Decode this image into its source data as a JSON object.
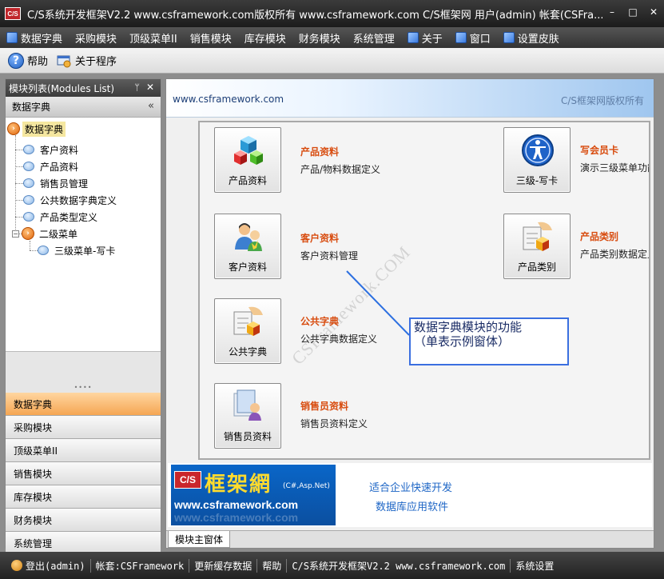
{
  "window": {
    "title": "C/S系统开发框架V2.2 www.csframework.com版权所有 www.csframework.com C/S框架网 用户(admin) 帐套(CSFra...",
    "logo_text": "C/S",
    "minimize": "–",
    "maximize": "□",
    "close": "✕"
  },
  "menu": [
    {
      "label": "数据字典",
      "icon": "dictionary-icon"
    },
    {
      "label": "采购模块"
    },
    {
      "label": "顶级菜单II"
    },
    {
      "label": "销售模块"
    },
    {
      "label": "库存模块"
    },
    {
      "label": "财务模块"
    },
    {
      "label": "系统管理"
    },
    {
      "label": "关于",
      "icon": "about-icon"
    },
    {
      "label": "窗口",
      "icon": "window-icon"
    },
    {
      "label": "设置皮肤",
      "icon": "skin-icon"
    }
  ],
  "toolbar": {
    "help": "帮助",
    "about_program": "关于程序"
  },
  "left_panel": {
    "title": "模块列表(Modules List)",
    "pin": "ᛘ",
    "close": "✕",
    "group_title": "数据字典",
    "collapse": "«",
    "tree": [
      {
        "label": "数据字典",
        "level": 0
      },
      {
        "label": "客户资料",
        "level": 1
      },
      {
        "label": "产品资料",
        "level": 1
      },
      {
        "label": "销售员管理",
        "level": 1
      },
      {
        "label": "公共数据字典定义",
        "level": 1
      },
      {
        "label": "产品类型定义",
        "level": 1
      },
      {
        "label": "二级菜单",
        "level": 1
      },
      {
        "label": "三级菜单-写卡",
        "level": 2
      }
    ],
    "nav_buttons": [
      "数据字典",
      "采购模块",
      "顶级菜单II",
      "销售模块",
      "库存模块",
      "财务模块",
      "系统管理"
    ],
    "footer_chevron": "⌄"
  },
  "main": {
    "site": "www.csframework.com",
    "copyright": "C/S框架网版权所有",
    "tiles": [
      {
        "label": "产品资料",
        "title": "产品资料",
        "desc": "产品/物料数据定义"
      },
      {
        "label": "客户资料",
        "title": "客户资料",
        "desc": "客户资料管理"
      },
      {
        "label": "公共字典",
        "title": "公共字典",
        "desc": "公共字典数据定义"
      },
      {
        "label": "销售员资料",
        "title": "销售员资料",
        "desc": "销售员资料定义"
      },
      {
        "label": "三级-写卡",
        "title": "写会员卡",
        "desc": "演示三级菜单功能"
      },
      {
        "label": "产品类别",
        "title": "产品类别",
        "desc": "产品类别数据定义"
      }
    ],
    "watermark": "CSFramework.COM",
    "callout": {
      "line1": "数据字典模块的功能",
      "line2": "（单表示例窗体）"
    },
    "banner": {
      "cs": "C/S",
      "brand": "框架網",
      "brand_sub": "(C#,Asp.Net)",
      "url": "www.csframework.com",
      "slogan1": "适合企业快速开发",
      "slogan2": "数据库应用软件"
    },
    "tab": "模块主窗体"
  },
  "status": [
    "登出(admin)",
    "帐套:CSFramework",
    "更新缓存数据",
    "帮助",
    "C/S系统开发框架V2.2 www.csframework.com",
    "系统设置"
  ],
  "colors": {
    "accent_orange": "#d84c0f",
    "title_bar": "#2a2a2a",
    "link_blue": "#1e66c6"
  }
}
